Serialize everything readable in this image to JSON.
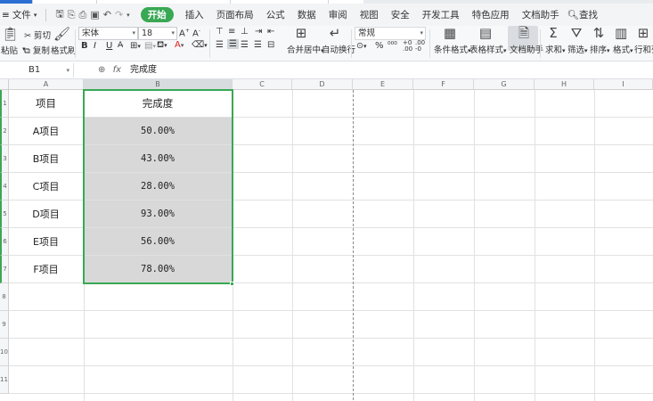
{
  "menubar": {
    "file_label": "文件",
    "tabs": [
      "开始",
      "插入",
      "页面布局",
      "公式",
      "数据",
      "审阅",
      "视图",
      "安全",
      "开发工具",
      "特色应用",
      "文档助手"
    ],
    "search_label": "查找"
  },
  "ribbon": {
    "paste": "粘贴",
    "cut": "剪切",
    "copy": "复制",
    "format_painter": "格式刷",
    "font_name": "宋体",
    "font_size": "18",
    "merge_center": "合并居中",
    "auto_wrap": "自动换行",
    "number_format": "常规",
    "conditional_format": "条件格式",
    "table_style": "表格样式",
    "doc_assistant": "文档助手",
    "sum": "求和",
    "filter": "筛选",
    "sort": "排序",
    "format": "格式",
    "row_col": "行和列"
  },
  "formula_bar": {
    "cell_ref": "B1",
    "fx": "fx",
    "value": "完成度"
  },
  "grid": {
    "columns": [
      "A",
      "B",
      "C",
      "D",
      "E",
      "F",
      "G",
      "H",
      "I"
    ],
    "rows": [
      "1",
      "2",
      "3",
      "4",
      "5",
      "6",
      "7",
      "8",
      "9",
      "10",
      "11"
    ],
    "header_a": "项目",
    "header_b": "完成度",
    "data": [
      {
        "item": "A项目",
        "value": "50.00%"
      },
      {
        "item": "B项目",
        "value": "43.00%"
      },
      {
        "item": "C项目",
        "value": "28.00%"
      },
      {
        "item": "D项目",
        "value": "93.00%"
      },
      {
        "item": "E项目",
        "value": "56.00%"
      },
      {
        "item": "F项目",
        "value": "78.00%"
      }
    ]
  },
  "colors": {
    "accent_green": "#39a854",
    "selected_fill": "#d8d8d8"
  }
}
